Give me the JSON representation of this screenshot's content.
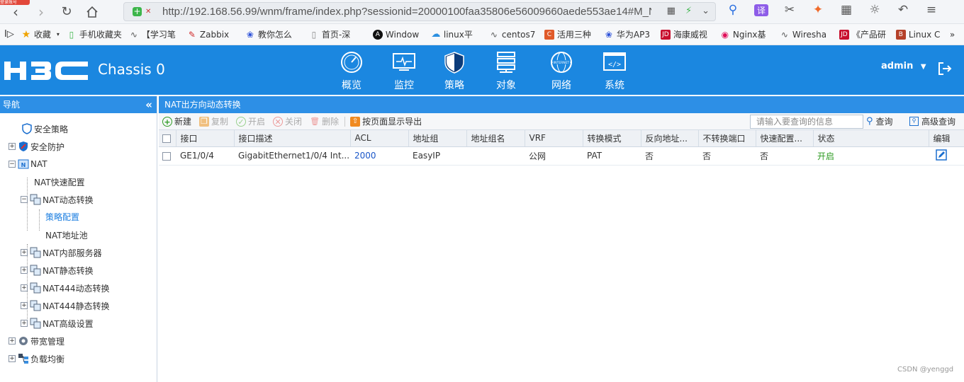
{
  "browser": {
    "tag": "登录账号",
    "url": "http://192.168.56.99/wnm/frame/index.php?sessionid=20000100faa35806e56009660aede553ae14#M_N"
  },
  "bookmarks": [
    {
      "label": "收藏",
      "color": "#f0a400"
    },
    {
      "label": "手机收藏夹",
      "color": "#3cb54a"
    },
    {
      "label": "【学习笔",
      "color": "#555555"
    },
    {
      "label": "Zabbix",
      "color": "#d02b2b"
    },
    {
      "label": "教你怎么",
      "color": "#2a4fd8"
    },
    {
      "label": "首页-深",
      "color": "#888888"
    },
    {
      "label": "Window",
      "color": "#111111"
    },
    {
      "label": "linux平",
      "color": "#2b8fe0"
    },
    {
      "label": "centos7",
      "color": "#555555"
    },
    {
      "label": "活用三种",
      "color": "#e05a2a"
    },
    {
      "label": "华为AP3",
      "color": "#2a4fd8"
    },
    {
      "label": "海康威视",
      "color": "#c8102e"
    },
    {
      "label": "Nginx基",
      "color": "#e0105a"
    },
    {
      "label": "Wiresha",
      "color": "#555555"
    },
    {
      "label": "《产品研",
      "color": "#c8102e"
    },
    {
      "label": "Linux C",
      "color": "#b5412a"
    }
  ],
  "header": {
    "logo": "H3C",
    "chassis": "Chassis 0",
    "nav": [
      {
        "label": "概览",
        "icon": "gauge-icon"
      },
      {
        "label": "监控",
        "icon": "monitor-icon"
      },
      {
        "label": "策略",
        "icon": "shield-icon"
      },
      {
        "label": "对象",
        "icon": "server-icon"
      },
      {
        "label": "网络",
        "icon": "globe-icon"
      },
      {
        "label": "系统",
        "icon": "code-icon"
      }
    ],
    "user": "admin"
  },
  "sidebar": {
    "title": "导航",
    "items": [
      {
        "label": "安全策略",
        "level": 0
      },
      {
        "label": "安全防护",
        "level": 0
      },
      {
        "label": "NAT",
        "level": 0
      },
      {
        "label": "NAT快速配置",
        "level": 1
      },
      {
        "label": "NAT动态转换",
        "level": 1
      },
      {
        "label": "策略配置",
        "level": 2
      },
      {
        "label": "NAT地址池",
        "level": 2
      },
      {
        "label": "NAT内部服务器",
        "level": 1
      },
      {
        "label": "NAT静态转换",
        "level": 1
      },
      {
        "label": "NAT444动态转换",
        "level": 1
      },
      {
        "label": "NAT444静态转换",
        "level": 1
      },
      {
        "label": "NAT高级设置",
        "level": 1
      },
      {
        "label": "带宽管理",
        "level": 0
      },
      {
        "label": "负载均衡",
        "level": 0
      }
    ]
  },
  "content": {
    "title": "NAT出方向动态转换",
    "toolbar": {
      "new": "新建",
      "copy": "复制",
      "enable": "开启",
      "disable": "关闭",
      "delete": "删除",
      "export": "按页面显示导出",
      "search_placeholder": "请输入要查询的信息",
      "query": "查询",
      "advanced": "高级查询"
    },
    "columns": [
      "接口",
      "接口描述",
      "ACL",
      "地址组",
      "地址组名",
      "VRF",
      "转换模式",
      "反向地址...",
      "不转换端口",
      "快速配置...",
      "状态",
      "编辑"
    ],
    "rows": [
      {
        "interface": "GE1/0/4",
        "desc": "GigabitEthernet1/0/4 Int...",
        "acl": "2000",
        "group": "EasyIP",
        "group_name": "",
        "vrf": "公网",
        "mode": "PAT",
        "reverse": "否",
        "no_port": "否",
        "quick": "否",
        "status": "开启"
      }
    ]
  },
  "watermark": "CSDN @yenggd"
}
